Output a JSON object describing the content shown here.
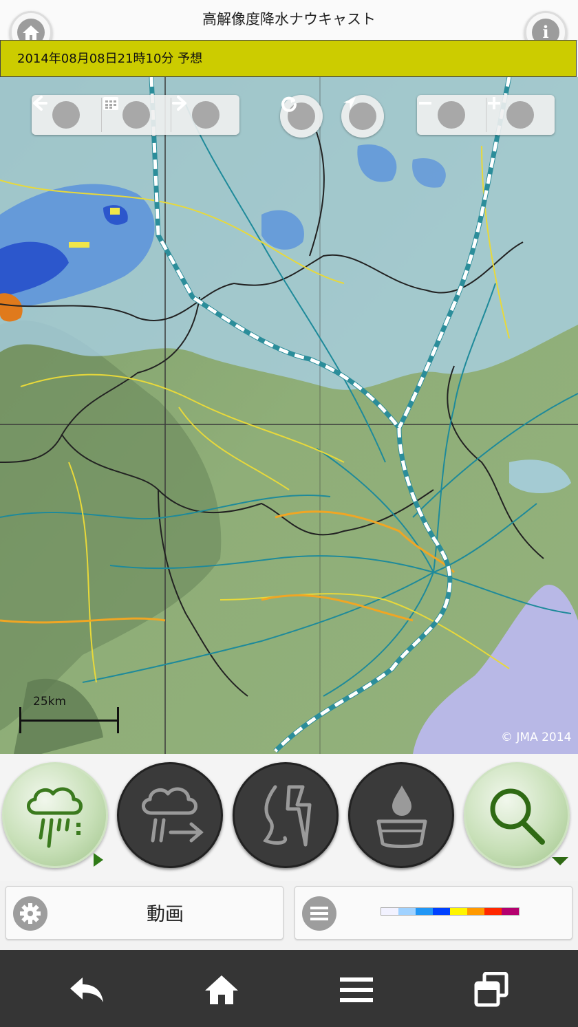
{
  "header": {
    "title": "高解像度降水ナウキャスト"
  },
  "datebar": {
    "text": "2014年08月08日21時10分 予想"
  },
  "map": {
    "scale_label": "25km",
    "copyright": "© JMA 2014",
    "water_color": "#b8b8e6",
    "rain_colors": [
      "#a9d2ea",
      "#5a92dc",
      "#1e46c8",
      "#f0e64a",
      "#e07a1c"
    ]
  },
  "map_controls": {
    "prev_icon": "arrow-left-icon",
    "calendar_icon": "calendar-icon",
    "next_icon": "arrow-right-icon",
    "reload_icon": "reload-icon",
    "locate_icon": "locate-icon",
    "zoom_out_icon": "minus-icon",
    "zoom_in_icon": "plus-icon"
  },
  "modes": [
    {
      "name": "rain-mode",
      "icon": "rain-cloud-icon",
      "selected": true
    },
    {
      "name": "forecast-mode",
      "icon": "cloud-arrow-icon",
      "selected": false
    },
    {
      "name": "tornado-mode",
      "icon": "tornado-lightning-icon",
      "selected": false
    },
    {
      "name": "rainfall-amount-mode",
      "icon": "water-drop-bowl-icon",
      "selected": false
    },
    {
      "name": "search-mode",
      "icon": "magnifier-icon",
      "selected": false
    }
  ],
  "settings": {
    "animation_label": "動画",
    "legend_colors": [
      "#f2f2ff",
      "#a0d2ff",
      "#2196f5",
      "#0041ff",
      "#fff500",
      "#ff9900",
      "#ff2800",
      "#b4006e"
    ]
  },
  "accent_color": "#cccc00"
}
